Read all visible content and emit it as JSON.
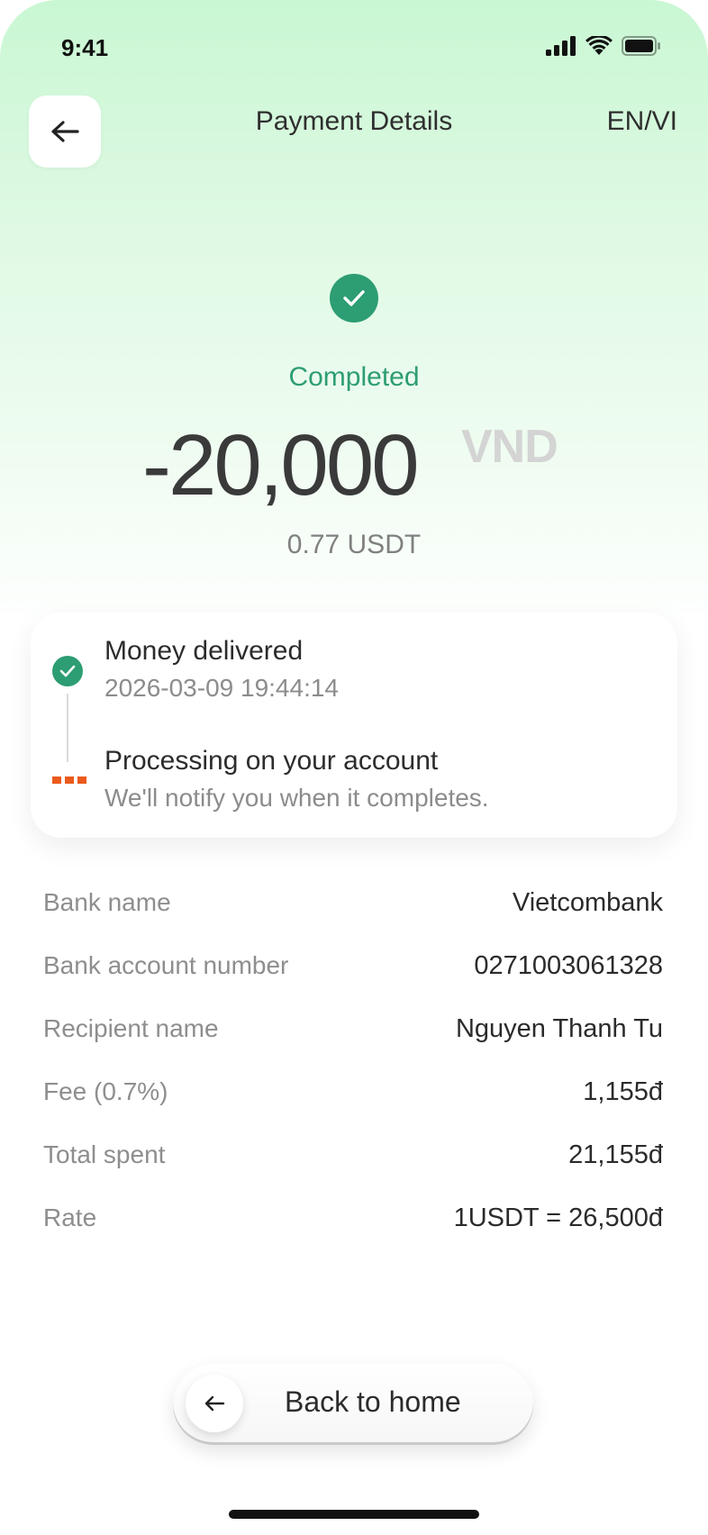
{
  "status_bar": {
    "time": "9:41",
    "icons": [
      "signal-icon",
      "wifi-icon",
      "battery-icon"
    ]
  },
  "header": {
    "title": "Payment Details",
    "lang_toggle": "EN/VI",
    "back_icon": "arrow-left-icon"
  },
  "payment": {
    "status": "Completed",
    "amount": "-20,000",
    "currency": "VND",
    "usdt_amount": "0.77 USDT"
  },
  "timeline": [
    {
      "title": "Money delivered",
      "subtitle": "2026-03-09 19:44:14",
      "state": "done"
    },
    {
      "title": "Processing on your account",
      "subtitle": "We'll notify you when it completes.",
      "state": "pending"
    }
  ],
  "details": [
    {
      "label": "Bank name",
      "value": "Vietcombank"
    },
    {
      "label": "Bank account number",
      "value": "0271003061328"
    },
    {
      "label": "Recipient name",
      "value": "Nguyen Thanh Tu"
    },
    {
      "label": "Fee (0.7%)",
      "value": "1,155đ"
    },
    {
      "label": "Total spent",
      "value": "21,155đ"
    },
    {
      "label": "Rate",
      "value": "1USDT = 26,500đ"
    }
  ],
  "footer": {
    "back_home_label": "Back to home"
  },
  "colors": {
    "accent_green": "#2d9d73",
    "pending_orange": "#ea5a1c"
  }
}
